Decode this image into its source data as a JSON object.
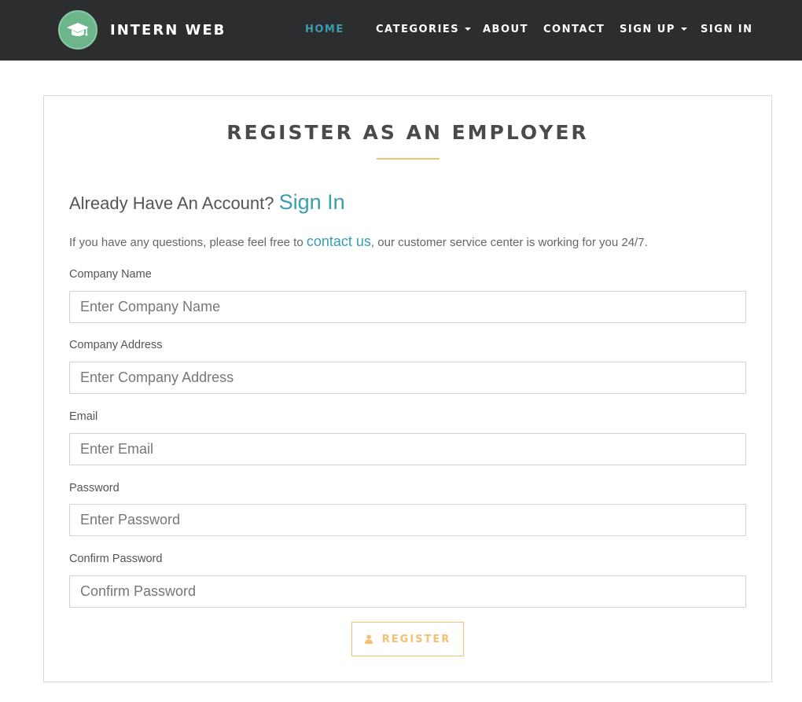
{
  "brand": {
    "name": "INTERN WEB",
    "icon": "graduation-cap-icon",
    "color": "#6db58a"
  },
  "nav": {
    "home": "HOME",
    "categories": "CATEGORIES",
    "about": "ABOUT",
    "contact": "CONTACT",
    "signup": "SIGN UP",
    "signin": "SIGN IN",
    "active_color": "#3a9db0",
    "background": "#2b2d2f"
  },
  "form": {
    "title": "REGISTER AS AN EMPLOYER",
    "already_text": "Already Have An Account?",
    "signin_link": "Sign In",
    "help_before": "If you have any questions, please feel free to ",
    "help_link": "contact us",
    "help_after": ", our customer service center is working for you 24/7.",
    "fields": {
      "company_name": {
        "label": "Company Name",
        "placeholder": "Enter Company Name",
        "value": ""
      },
      "company_address": {
        "label": "Company Address",
        "placeholder": "Enter Company Address",
        "value": ""
      },
      "email": {
        "label": "Email",
        "placeholder": "Enter Email",
        "value": ""
      },
      "password": {
        "label": "Password",
        "placeholder": "Enter Password",
        "value": ""
      },
      "confirm_password": {
        "label": "Confirm Password",
        "placeholder": "Confirm Password",
        "value": ""
      }
    },
    "submit_label": "REGISTER",
    "submit_icon": "user-icon",
    "accent_color": "#f5c070"
  }
}
